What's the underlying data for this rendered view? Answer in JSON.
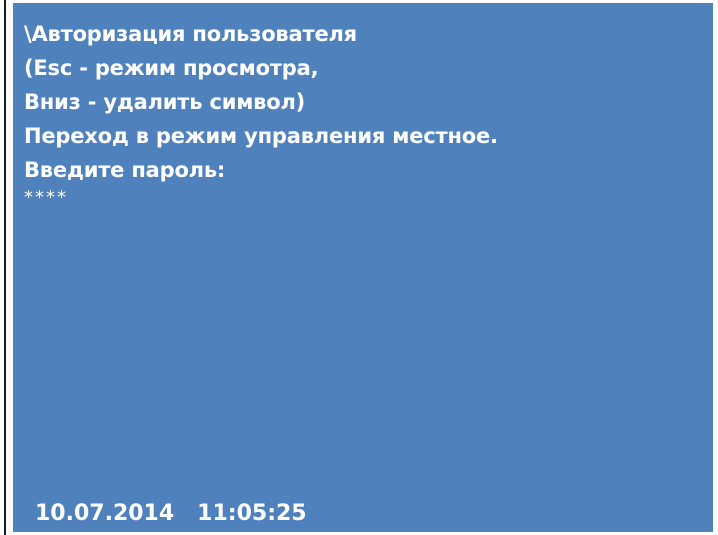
{
  "screen": {
    "title": "\\Авторизация пользователя",
    "hint_line1": "(Esc - режим просмотра,",
    "hint_line2": "Вниз - удалить символ)",
    "message": "Переход в режим управления местное.",
    "prompt": "Введите пароль:",
    "password_mask": "****"
  },
  "status": {
    "date": "10.07.2014",
    "time": "11:05:25"
  },
  "colors": {
    "screen_background": "#4f81bd",
    "text": "#ffffff"
  }
}
